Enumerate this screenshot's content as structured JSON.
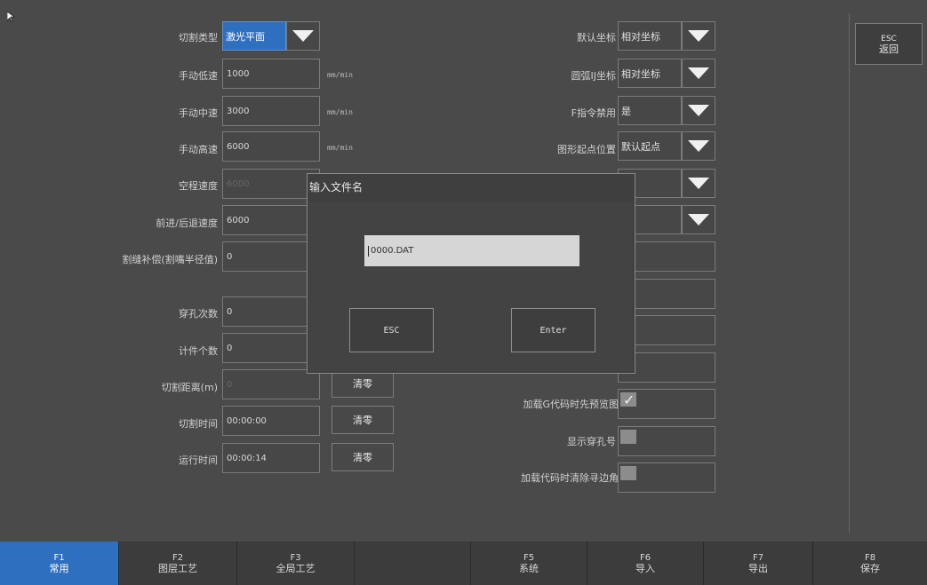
{
  "left_params": {
    "cut_type": {
      "label": "切割类型",
      "value": "激光平面"
    },
    "manual_low": {
      "label": "手动低速",
      "value": "1000",
      "unit": "mm/min"
    },
    "manual_mid": {
      "label": "手动中速",
      "value": "3000",
      "unit": "mm/min"
    },
    "manual_high": {
      "label": "手动高速",
      "value": "6000",
      "unit": "mm/min"
    },
    "idle_speed": {
      "label": "空程速度",
      "value": "6000"
    },
    "fwd_back_speed": {
      "label": "前进/后退速度",
      "value": "6000"
    },
    "kerf_comp": {
      "label": "割缝补偿(割嘴半径值)",
      "value": "0"
    },
    "pierce_count": {
      "label": "穿孔次数",
      "value": "0"
    },
    "piece_count": {
      "label": "计件个数",
      "value": "0"
    },
    "cut_distance": {
      "label": "切割距离(m)",
      "value": "0",
      "clear": "清零"
    },
    "cut_time": {
      "label": "切割时间",
      "value": "00:00:00",
      "clear": "清零"
    },
    "run_time": {
      "label": "运行时间",
      "value": "00:00:14",
      "clear": "清零"
    }
  },
  "right_params": {
    "default_coord": {
      "label": "默认坐标",
      "value": "相对坐标"
    },
    "arc_ij_coord": {
      "label": "圆弧IJ坐标",
      "value": "相对坐标"
    },
    "f_disable": {
      "label": "F指令禁用",
      "value": "是"
    },
    "shape_start": {
      "label": "图形起点位置",
      "value": "默认起点"
    },
    "preview_on_load": {
      "label": "加载G代码时先预览图形",
      "checked": true
    },
    "show_pierce_no": {
      "label": "显示穿孔号",
      "checked": false
    },
    "clear_edge_angle": {
      "label": "加载代码时清除寻边角度",
      "checked": false
    }
  },
  "side": {
    "esc_key": "ESC",
    "esc_label": "返回"
  },
  "dialog": {
    "title": "输入文件名",
    "input_value": "0000.DAT",
    "esc_label": "ESC",
    "enter_label": "Enter"
  },
  "fkeys": [
    {
      "key": "F1",
      "label": "常用"
    },
    {
      "key": "F2",
      "label": "图层工艺"
    },
    {
      "key": "F3",
      "label": "全局工艺"
    },
    {
      "key": "",
      "label": ""
    },
    {
      "key": "F5",
      "label": "系统"
    },
    {
      "key": "F6",
      "label": "导入"
    },
    {
      "key": "F7",
      "label": "导出"
    },
    {
      "key": "F8",
      "label": "保存"
    }
  ]
}
